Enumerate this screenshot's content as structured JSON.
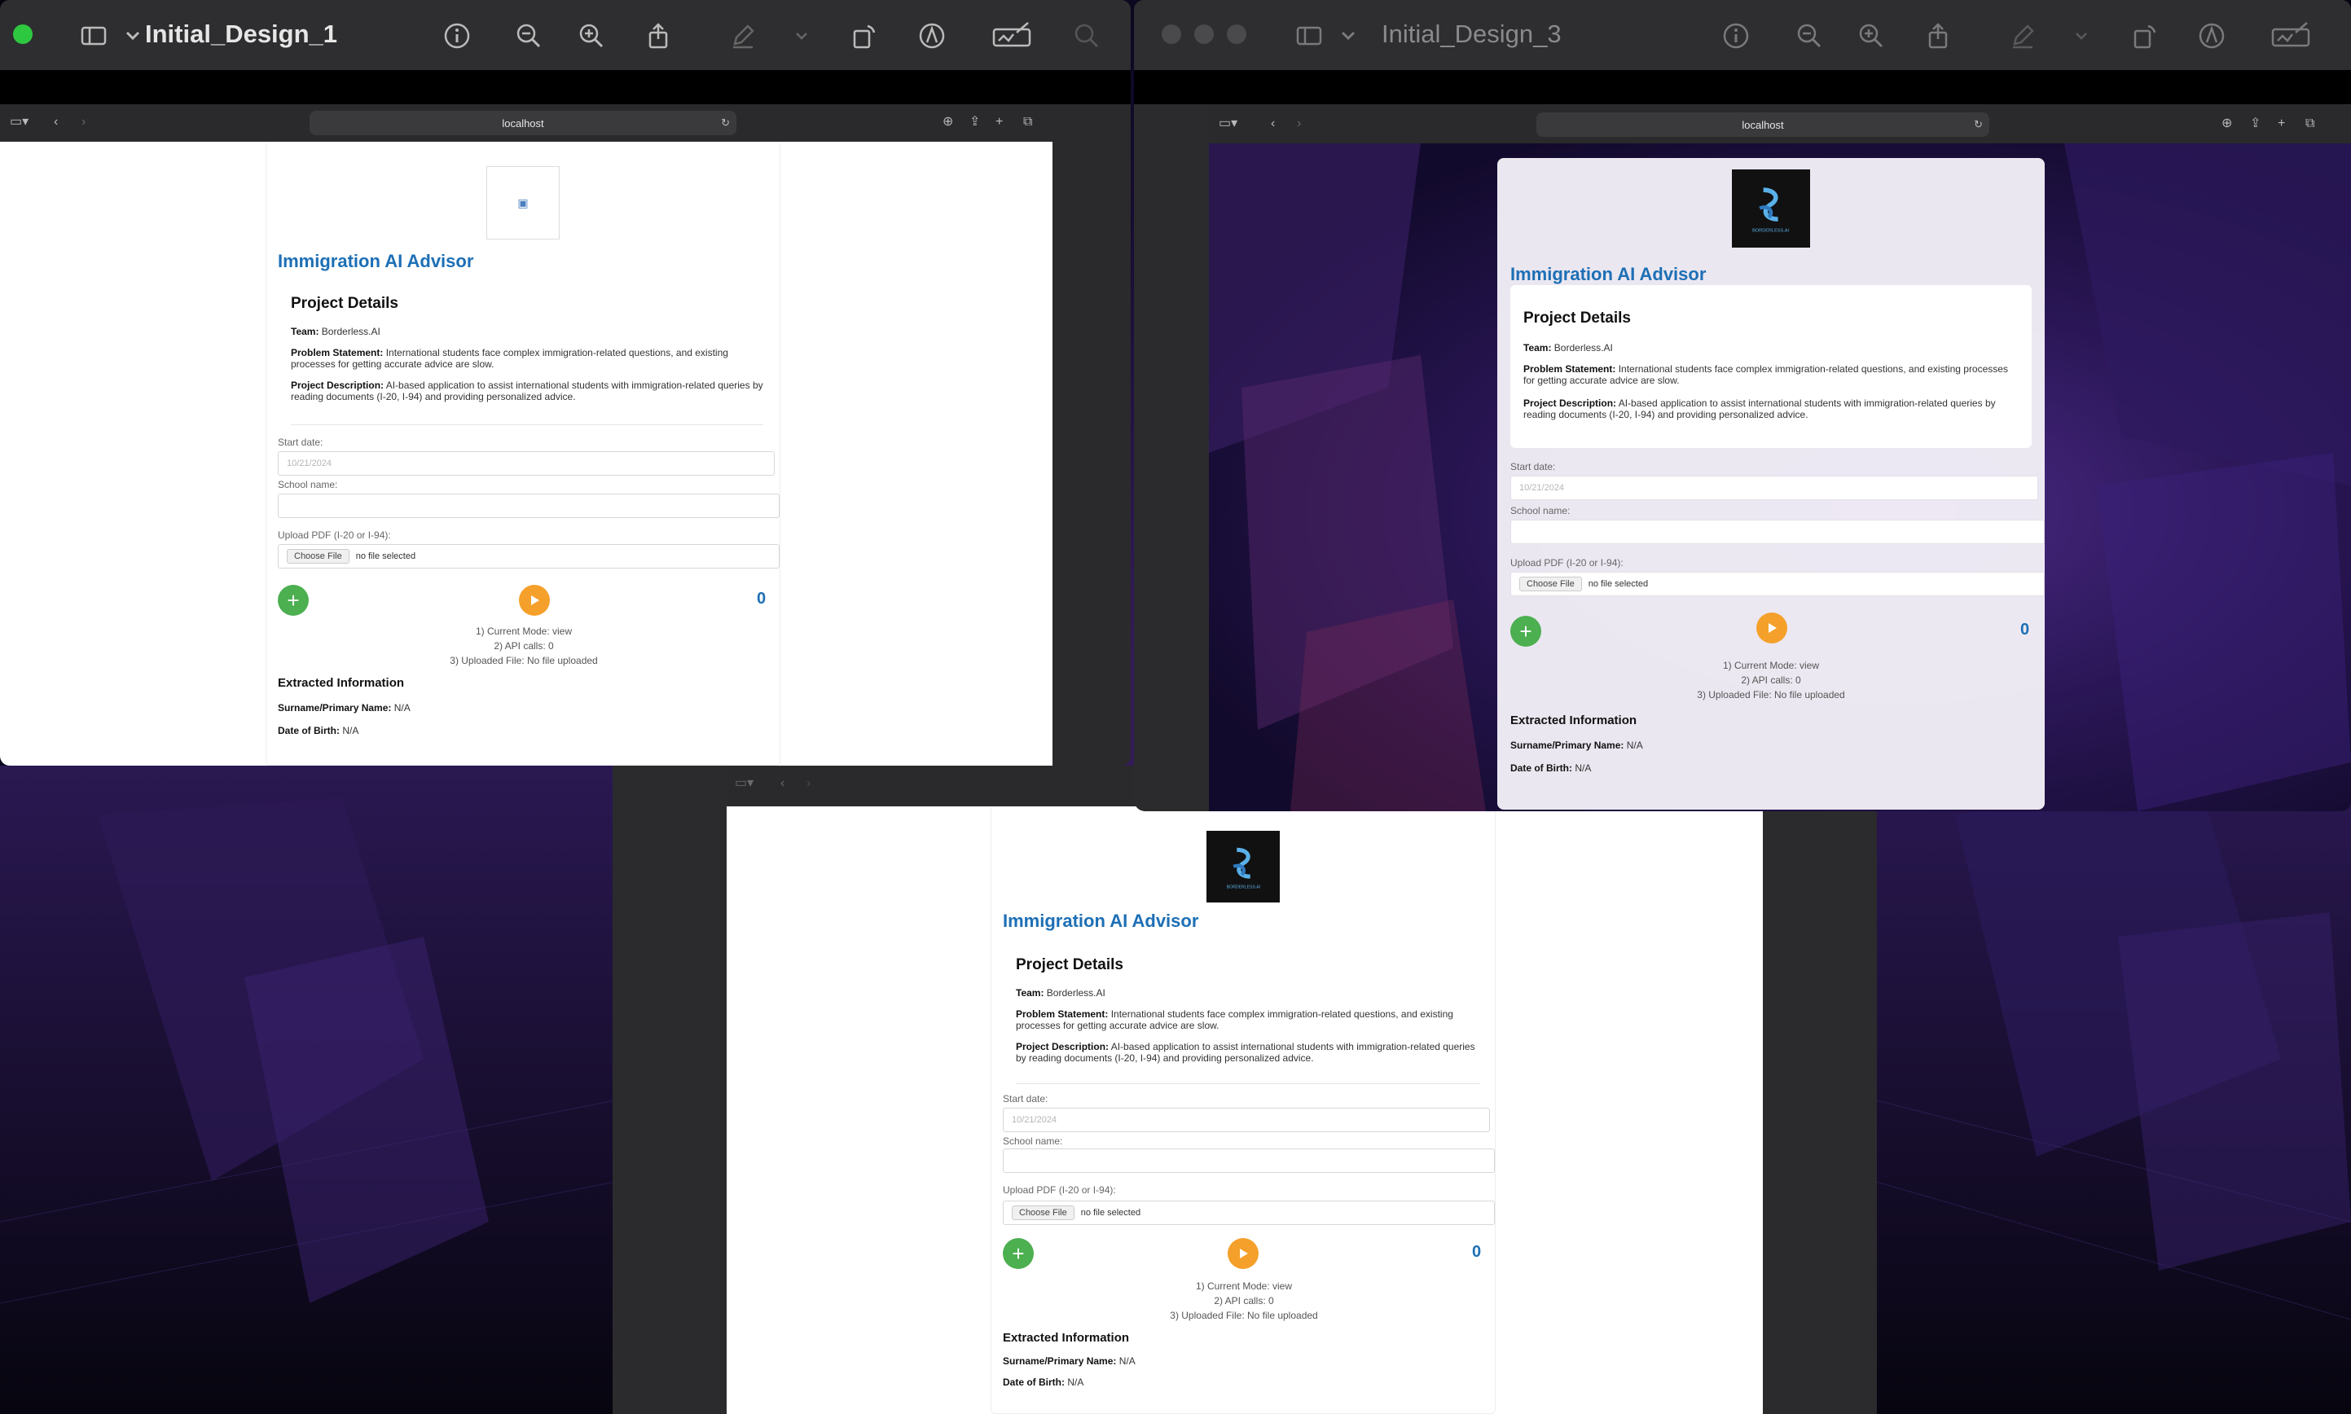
{
  "windows": {
    "w1": {
      "title": "Initial_Design_1"
    },
    "w3": {
      "title": "Initial_Design_3"
    }
  },
  "browser": {
    "address": "localhost"
  },
  "app": {
    "title": "Immigration AI Advisor",
    "logo_text": "BORDERLESS.AI",
    "project_details": {
      "heading": "Project Details",
      "team_label": "Team:",
      "team_value": "Borderless.AI",
      "problem_label": "Problem Statement:",
      "problem_value": "International students face complex immigration-related questions, and existing processes for getting accurate advice are slow.",
      "desc_label": "Project Description:",
      "desc_value": "AI-based application to assist international students with immigration-related queries by reading documents (I-20, I-94) and providing personalized advice."
    },
    "form": {
      "start_label": "Start date:",
      "start_placeholder": "10/21/2024",
      "school_label": "School name:",
      "school_value": "",
      "upload_label": "Upload PDF (I-20 or I-94):",
      "file_button": "Choose File",
      "file_status": "no file selected"
    },
    "controls": {
      "plus": "+",
      "counter": "0"
    },
    "status": {
      "mode": "1) Current Mode: view",
      "api": "2) API calls: 0",
      "file": "3) Uploaded File: No file uploaded"
    },
    "extracted": {
      "heading": "Extracted Information",
      "surname_label": "Surname/Primary Name:",
      "surname_value": "N/A",
      "dob_label": "Date of Birth:",
      "dob_value": "N/A"
    }
  },
  "icons": [
    "sidebar-icon",
    "chevron-down-icon",
    "info-icon",
    "zoom-out-icon",
    "zoom-in-icon",
    "share-icon",
    "markup-icon",
    "rotate-icon",
    "pen-icon",
    "signature-icon",
    "search-icon",
    "reload-icon",
    "download-icon",
    "plus-icon",
    "tabs-icon",
    "back-icon",
    "forward-icon",
    "play-icon"
  ],
  "colors": {
    "accent": "#1d6fb5",
    "plus": "#4caf50",
    "play": "#f5a02a",
    "traffic_green": "#2ec840"
  }
}
